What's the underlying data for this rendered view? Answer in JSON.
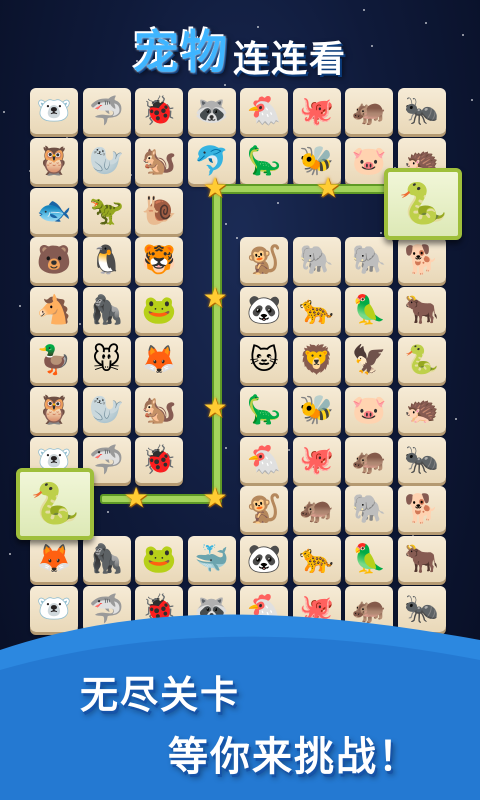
{
  "title": {
    "main": "宠物",
    "sub": "连连看"
  },
  "slogan": {
    "line1": "无尽关卡",
    "line2": "等你来挑战！"
  },
  "colors": {
    "title_blue": "#3fb5ff",
    "path_green": "#a3d45c",
    "star": "#ffcc33",
    "tile": "#f2e4c8",
    "wave": "#2c88e0"
  },
  "board": {
    "rows": [
      [
        "🐻‍❄️",
        "🦈",
        "🐞",
        "🦝",
        "🐔",
        "🐙",
        "🦛",
        "🐜"
      ],
      [
        "🦉",
        "🦭",
        "🐿️",
        "🐬",
        "🦕",
        "🐝",
        "🐷",
        "🦔"
      ],
      [
        "🐟",
        "🦖",
        "🐌",
        "",
        "",
        "",
        "",
        ""
      ],
      [
        "🐻",
        "🐧",
        "🐯",
        "",
        "🐒",
        "🐘",
        "🐘",
        "🐕"
      ],
      [
        "🐴",
        "🦍",
        "🐸",
        "",
        "🐼",
        "🐆",
        "🦜",
        "🐂"
      ],
      [
        "🦆",
        "🐭",
        "🦊",
        "",
        "🐱",
        "🦁",
        "🦅",
        "🐍"
      ],
      [
        "🦉",
        "🦭",
        "🐿️",
        "",
        "🦕",
        "🐝",
        "🐷",
        "🦔"
      ],
      [
        "🐻‍❄️",
        "🦈",
        "🐞",
        "",
        "🐔",
        "🐙",
        "🦛",
        "🐜"
      ],
      [
        "",
        "",
        "",
        "",
        "🐒",
        "🦛",
        "🐘",
        "🐕"
      ],
      [
        "🦊",
        "🦍",
        "🐸",
        "🐳",
        "🐼",
        "🐆",
        "🦜",
        "🐂"
      ],
      [
        "🐻‍❄️",
        "🦈",
        "🐞",
        "🦝",
        "🐔",
        "🐙",
        "🦛",
        "🐜"
      ]
    ],
    "selected": [
      "🐍",
      "🐍"
    ]
  }
}
